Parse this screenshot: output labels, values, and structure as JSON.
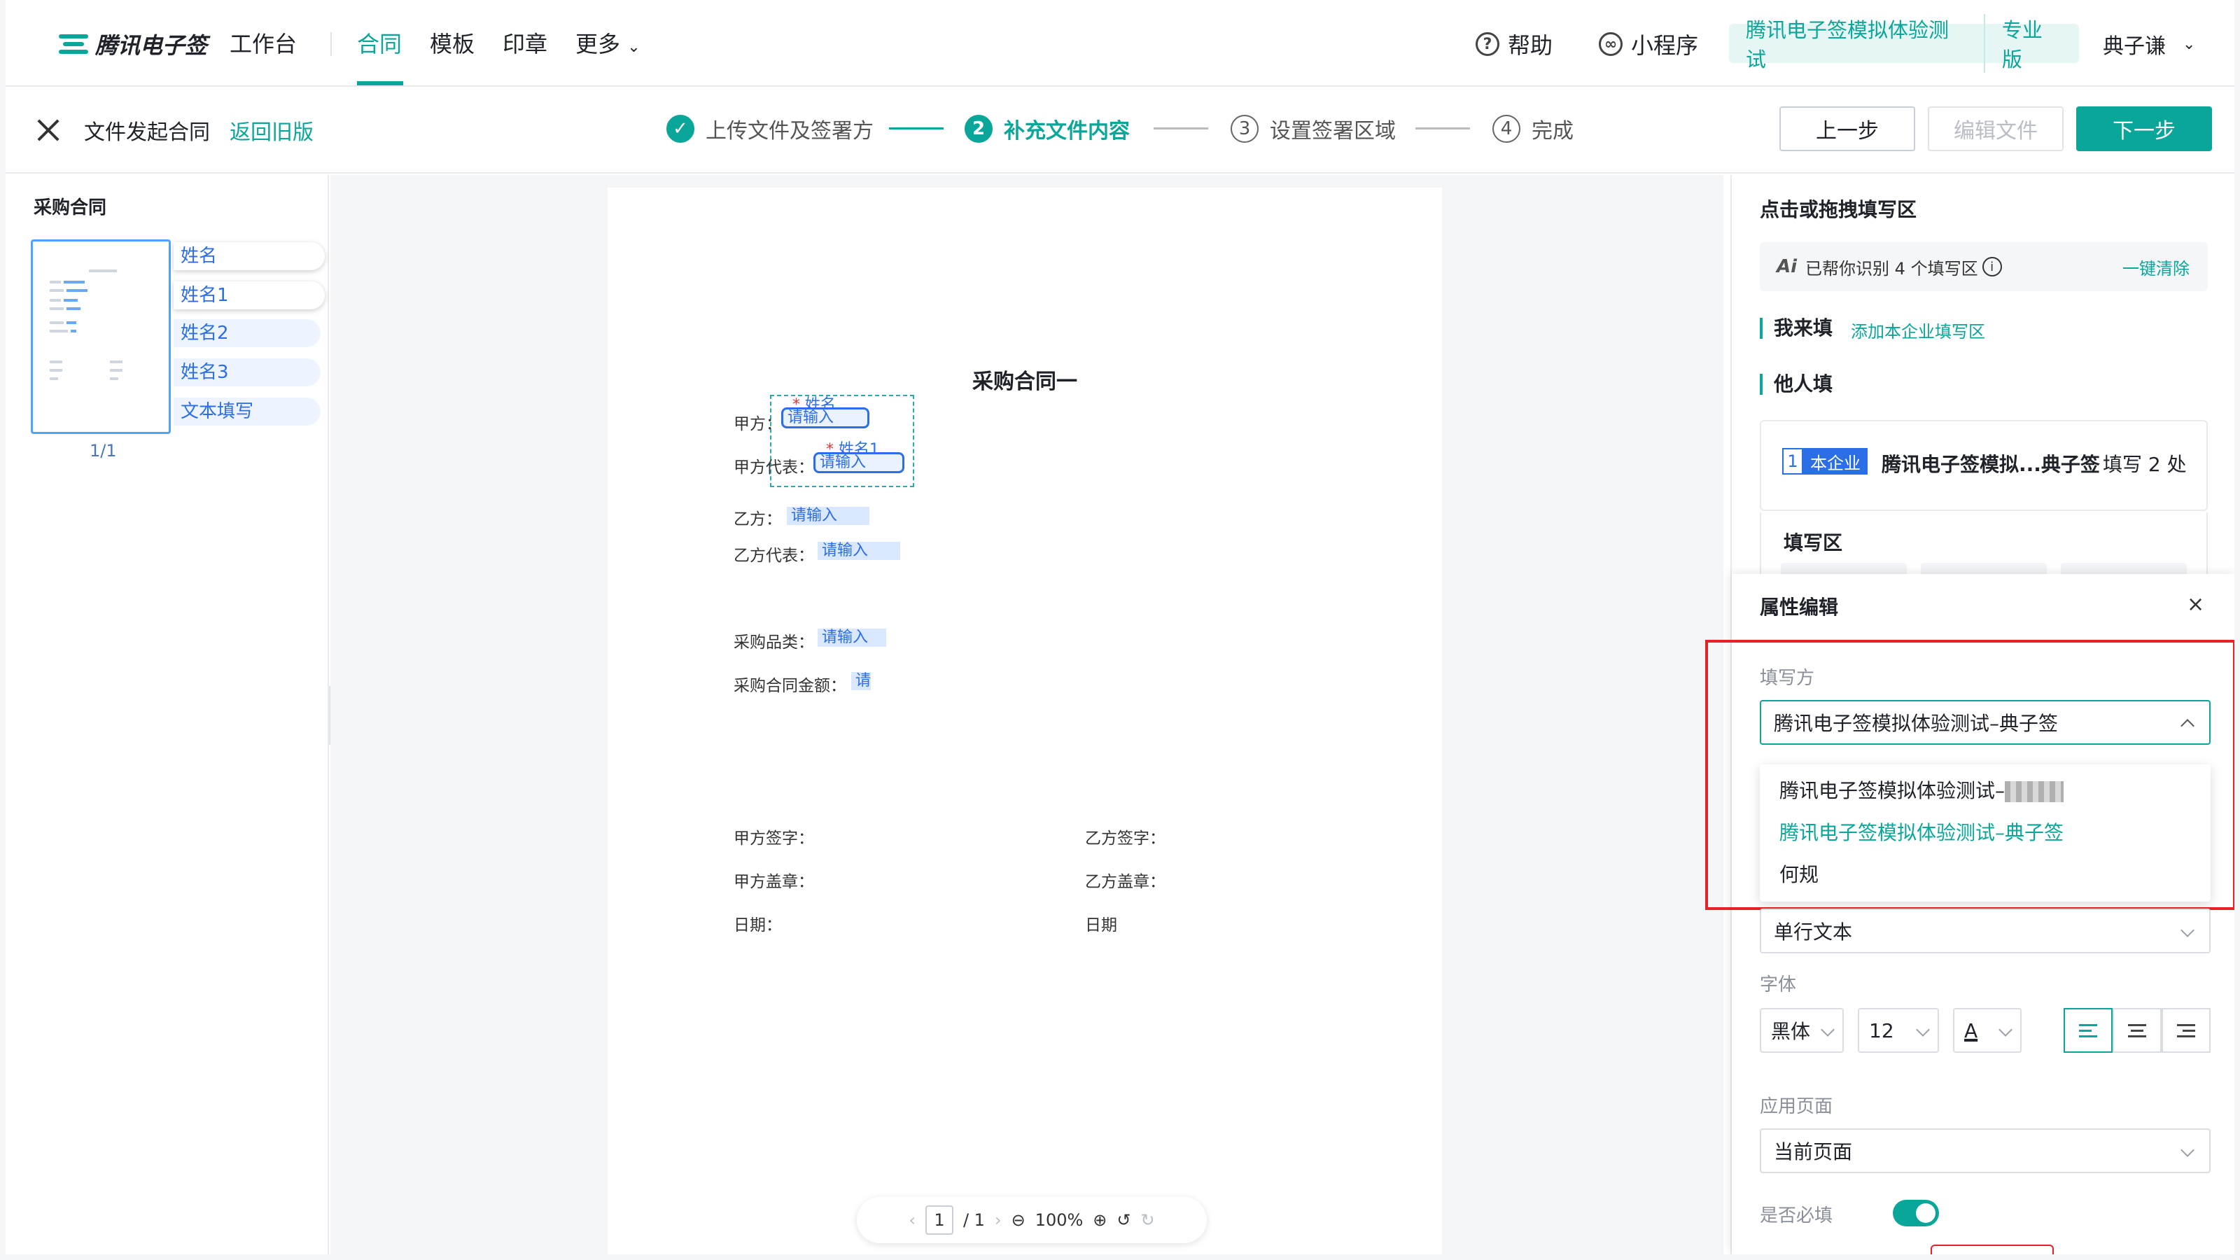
{
  "nav": {
    "logo": "腾讯电子签",
    "items": [
      "工作台",
      "合同",
      "模板",
      "印章",
      "更多"
    ],
    "help": "帮助",
    "miniprogram": "小程序",
    "org_name": "腾讯电子签模拟体验测试",
    "edition": "专业版",
    "user": "典子谦"
  },
  "stepbar": {
    "title": "文件发起合同",
    "back_link": "返回旧版",
    "steps": [
      {
        "num": "✓",
        "label": "上传文件及签署方",
        "state": "done"
      },
      {
        "num": "2",
        "label": "补充文件内容",
        "state": "active"
      },
      {
        "num": "3",
        "label": "设置签署区域",
        "state": "todo"
      },
      {
        "num": "4",
        "label": "完成",
        "state": "todo"
      }
    ],
    "prev": "上一步",
    "edit": "编辑文件",
    "next": "下一步"
  },
  "left": {
    "title": "采购合同",
    "page": "1/1",
    "fields": [
      "姓名",
      "姓名1",
      "姓名2",
      "姓名3",
      "文本填写"
    ]
  },
  "doc": {
    "title": "采购合同一",
    "labels": {
      "party_a": "甲方：",
      "party_a_rep": "甲方代表：",
      "party_b": "乙方：",
      "party_b_rep": "乙方代表：",
      "category": "采购品类：",
      "amount": "采购合同金额：",
      "a_sign": "甲方签字：",
      "a_seal": "甲方盖章：",
      "a_date": "日期：",
      "b_sign": "乙方签字：",
      "b_seal": "乙方盖章：",
      "b_date": "日期"
    },
    "placeholder": "请输入",
    "placeholder_short": "请",
    "required_mark": "*",
    "field_name_1": "姓名",
    "field_name_2": "姓名1",
    "zoom": {
      "page": "1",
      "total": "/ 1",
      "level": "100%"
    }
  },
  "right": {
    "title": "点击或拖拽填写区",
    "ai_badge": "Ai",
    "ai_text": "已帮你识别 4 个填写区",
    "ai_clear": "一键清除",
    "self_fill": "我来填",
    "add_company_zone": "添加本企业填写区",
    "others_fill": "他人填",
    "party": {
      "num": "1",
      "tag": "本企业",
      "name": "腾讯电子签模拟...典子签",
      "count": "填写 2 处"
    },
    "fill_zone": "填写区"
  },
  "props": {
    "title": "属性编辑",
    "filler_label": "填写方",
    "filler_value": "腾讯电子签模拟体验测试–典子签",
    "filler_options": [
      {
        "label": "腾讯电子签模拟体验测试–",
        "selected": false,
        "redacted": true
      },
      {
        "label": "腾讯电子签模拟体验测试–典子签",
        "selected": true,
        "redacted": false
      },
      {
        "label": "何规",
        "selected": false,
        "redacted": false
      }
    ],
    "type_value": "单行文本",
    "font_label": "字体",
    "font_family": "黑体",
    "font_size": "12",
    "font_color_glyph": "A",
    "apply_label": "应用页面",
    "apply_value": "当前页面",
    "required_label": "是否必填",
    "required_on": true
  },
  "colors": {
    "accent": "#0aa699",
    "field_blue": "#2b6ee6",
    "highlight_red": "#e8202a"
  }
}
